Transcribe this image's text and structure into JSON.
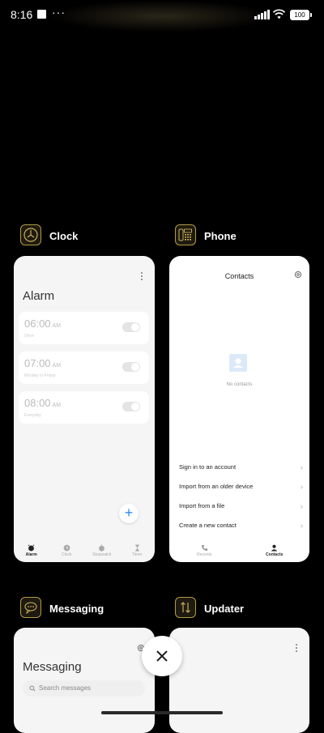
{
  "status_bar": {
    "time": "8:16",
    "more": "···",
    "battery": "100"
  },
  "apps": [
    {
      "name": "Clock",
      "icon": "clock-icon",
      "screen": {
        "title": "Alarm",
        "alarms": [
          {
            "time": "06:00",
            "ampm": "AM",
            "detail": "Once"
          },
          {
            "time": "07:00",
            "ampm": "AM",
            "detail": "Monday to Friday"
          },
          {
            "time": "08:00",
            "ampm": "AM",
            "detail": "Everyday"
          }
        ],
        "tabs": [
          {
            "label": "Alarm",
            "icon": "alarm-icon",
            "active": true
          },
          {
            "label": "Clock",
            "icon": "clock-icon",
            "active": false
          },
          {
            "label": "Stopwatch",
            "icon": "stopwatch-icon",
            "active": false
          },
          {
            "label": "Timer",
            "icon": "hourglass-icon",
            "active": false
          }
        ],
        "fab": "+"
      }
    },
    {
      "name": "Phone",
      "icon": "phone-icon",
      "screen": {
        "title": "Contacts",
        "empty_text": "No contacts",
        "options": [
          "Sign in to an account",
          "Import from an older device",
          "Import from a file",
          "Create a new contact"
        ],
        "tabs": [
          {
            "label": "Recents",
            "icon": "phone-handset-icon",
            "active": false
          },
          {
            "label": "Contacts",
            "icon": "person-icon",
            "active": true
          }
        ]
      }
    },
    {
      "name": "Messaging",
      "icon": "chat-bubbles-icon",
      "screen": {
        "title": "Messaging",
        "search_placeholder": "Search messages"
      }
    },
    {
      "name": "Updater",
      "icon": "update-arrows-icon",
      "screen": {}
    }
  ],
  "close_button": "close-icon"
}
